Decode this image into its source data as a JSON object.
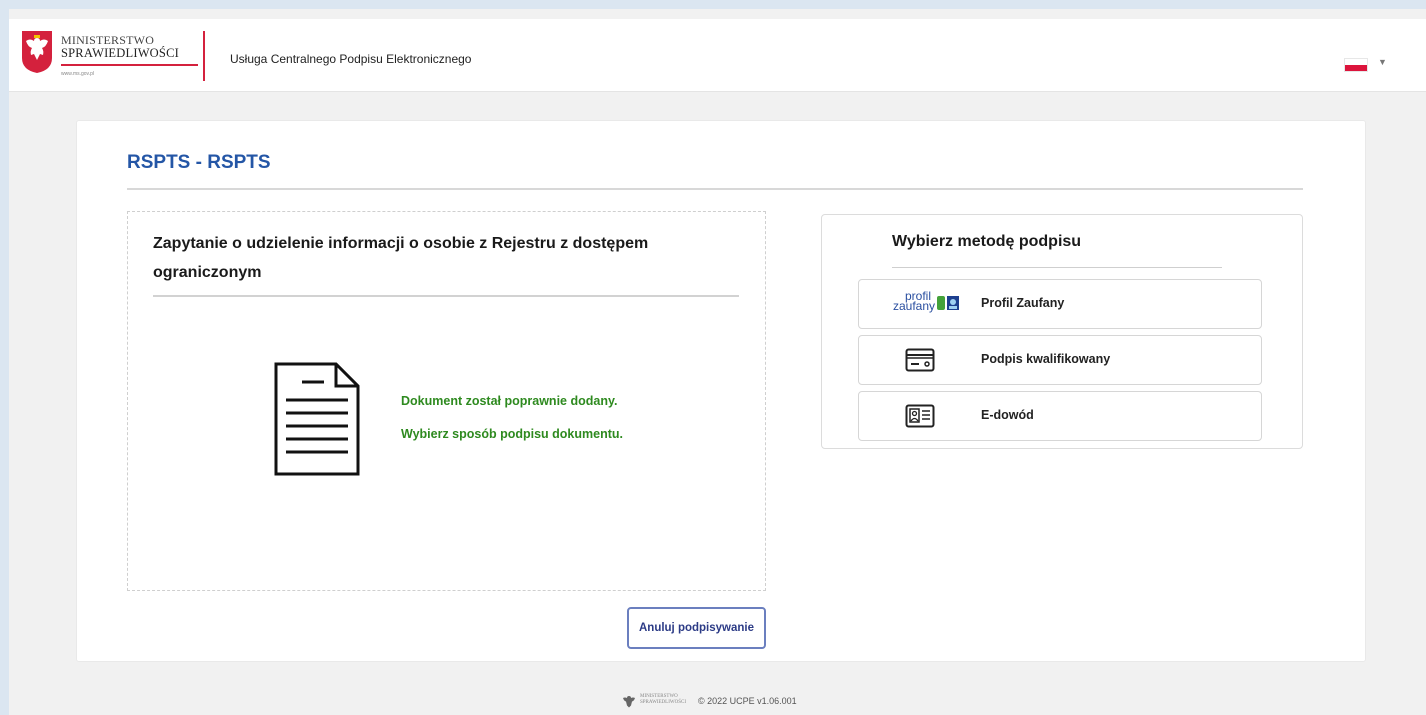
{
  "header": {
    "logo_line1": "MINISTERSTWO",
    "logo_line2": "SPRAWIEDLIWOŚCI",
    "logo_url": "www.ms.gov.pl",
    "service_title": "Usługa Centralnego Podpisu Elektronicznego",
    "language_flag": "flag-pl",
    "brand_red": "#d4213d"
  },
  "page": {
    "title": "RSPTS - RSPTS"
  },
  "document": {
    "title": "Zapytanie o udzielenie informacji o osobie z Rejestru z dostępem ograniczonym",
    "icon": "document-icon",
    "status_line1": "Dokument został poprawnie dodany.",
    "status_line2": "Wybierz sposób podpisu dokumentu.",
    "status_color": "#2e8a1f"
  },
  "actions": {
    "cancel_label": "Anuluj podpisywanie"
  },
  "signing": {
    "title": "Wybierz metodę podpisu",
    "methods": [
      {
        "label": "Profil Zaufany",
        "icon": "profil-zaufany-icon",
        "icon_text_top": "profil",
        "icon_text_bottom": "zaufany"
      },
      {
        "label": "Podpis kwalifikowany",
        "icon": "card-reader-icon"
      },
      {
        "label": "E-dowód",
        "icon": "id-card-icon"
      }
    ]
  },
  "footer": {
    "ministry_line1": "MINISTERSTWO",
    "ministry_line2": "SPRAWIEDLIWOŚCI",
    "text": "© 2022 UCPE v1.06.001"
  },
  "colors": {
    "title_blue": "#2456a6",
    "button_border": "#6b7fbf"
  }
}
